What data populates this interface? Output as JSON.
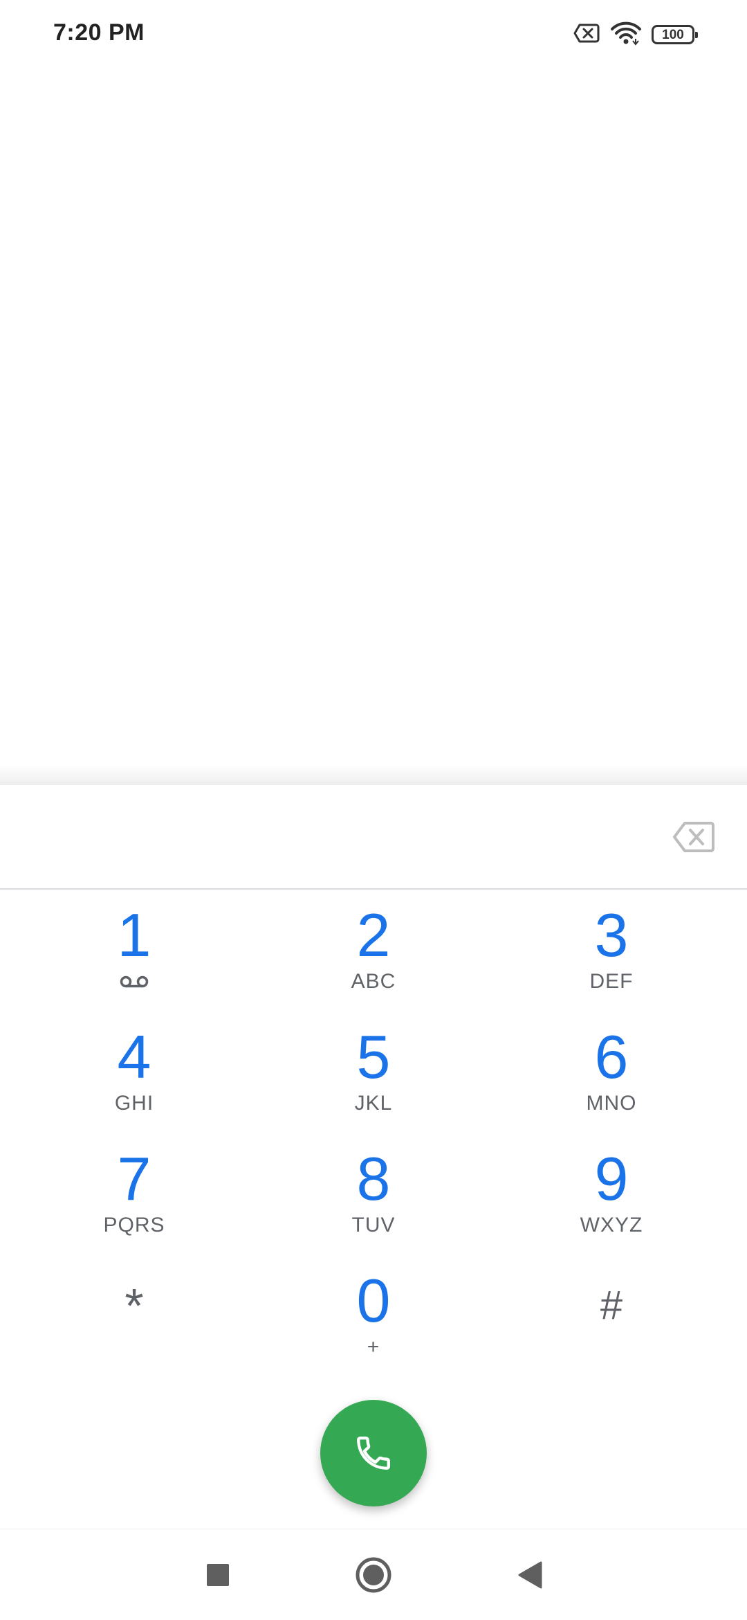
{
  "status_bar": {
    "time": "7:20 PM",
    "battery_level": "100",
    "icons": [
      "no-sim-icon",
      "wifi-icon",
      "battery-icon"
    ]
  },
  "dialpad": {
    "digits_value": "",
    "keys": [
      {
        "digit": "1",
        "letters": "",
        "icon": "voicemail-icon"
      },
      {
        "digit": "2",
        "letters": "ABC"
      },
      {
        "digit": "3",
        "letters": "DEF"
      },
      {
        "digit": "4",
        "letters": "GHI"
      },
      {
        "digit": "5",
        "letters": "JKL"
      },
      {
        "digit": "6",
        "letters": "MNO"
      },
      {
        "digit": "7",
        "letters": "PQRS"
      },
      {
        "digit": "8",
        "letters": "TUV"
      },
      {
        "digit": "9",
        "letters": "WXYZ"
      },
      {
        "digit": "*",
        "letters": ""
      },
      {
        "digit": "0",
        "letters": "+"
      },
      {
        "digit": "#",
        "letters": ""
      }
    ]
  },
  "call_button": {
    "icon": "phone-icon"
  },
  "navigation": {
    "buttons": [
      "recents-square-icon",
      "home-circle-icon",
      "back-triangle-icon"
    ]
  },
  "colors": {
    "digit": "#1a73e8",
    "letters": "#5f6368",
    "call": "#34a853"
  }
}
